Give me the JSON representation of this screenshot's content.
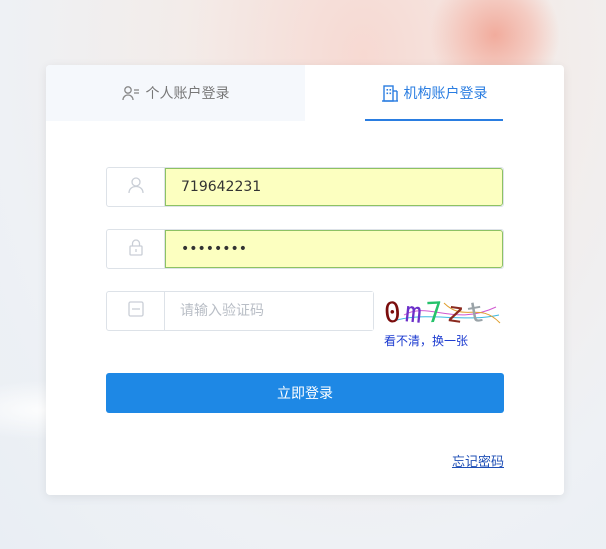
{
  "tabs": {
    "personal_label": "个人账户登录",
    "org_label": "机构账户登录"
  },
  "form": {
    "username_value": "719642231",
    "password_value": "••••••••",
    "captcha_placeholder": "请输入验证码",
    "captcha_chars": [
      "0",
      "m",
      "7",
      "z",
      "t"
    ],
    "captcha_colors": [
      "#7a0d0d",
      "#6b2fc9",
      "#25c26a",
      "#8a2a1f",
      "#9aa3a8"
    ],
    "captcha_refresh_label": "看不清，换一张",
    "login_button_label": "立即登录",
    "forgot_password_label": "忘记密码"
  },
  "colors": {
    "accent": "#1e88e5",
    "tab_active": "#2a7de1",
    "autofill_bg": "#fcffc0"
  }
}
